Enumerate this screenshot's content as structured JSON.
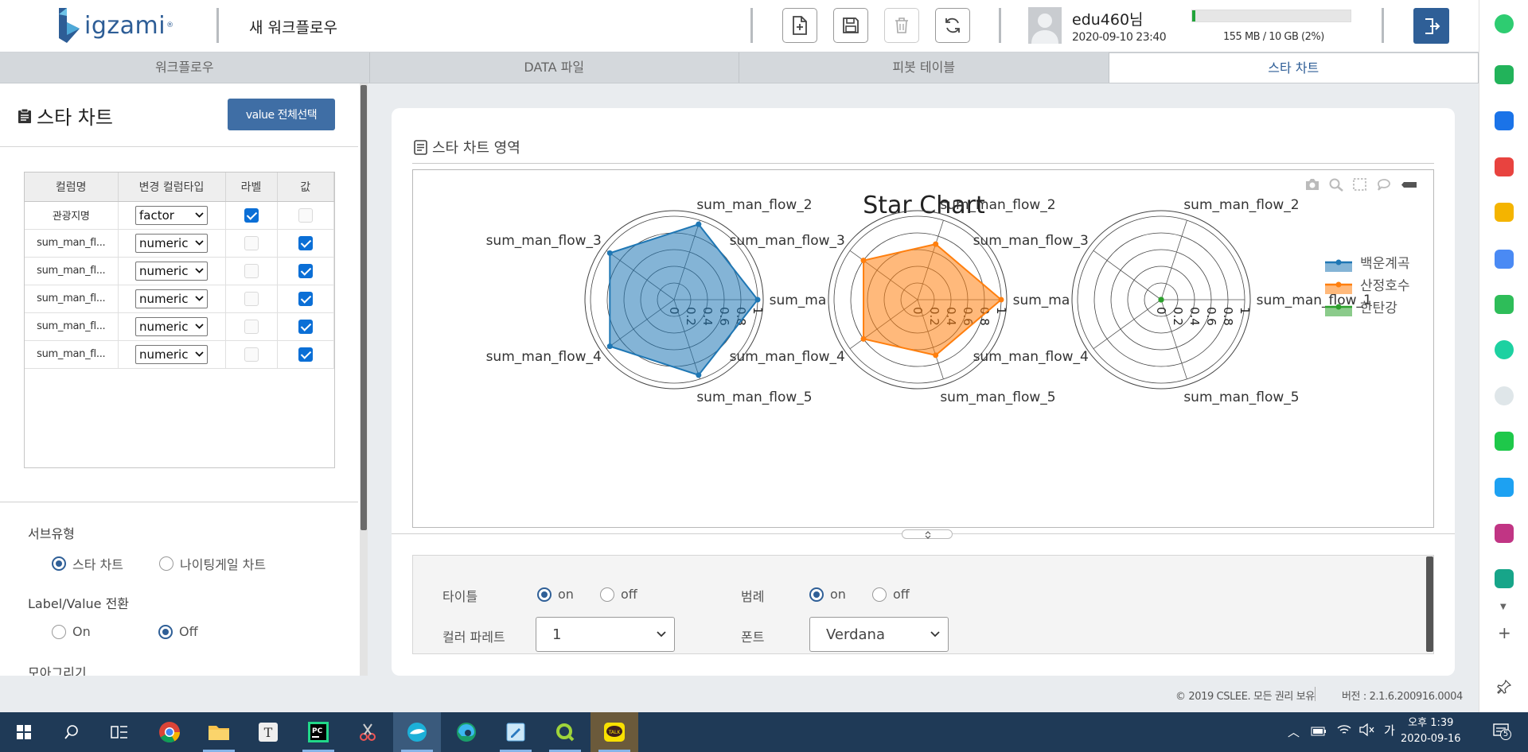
{
  "header": {
    "logo_text": "igzami",
    "logo_reg": "®",
    "workflow_title": "새 워크플로우",
    "user": {
      "name": "edu460님",
      "login_time": "2020-09-10 23:40"
    },
    "storage": {
      "text": "155 MB / 10 GB (2%)",
      "fraction": 0.02,
      "color": "#22a43a"
    },
    "toolbar_icons": [
      "new-file-icon",
      "save-icon",
      "trash-icon",
      "refresh-icon"
    ],
    "logout_icon": "logout-icon"
  },
  "tabs": [
    {
      "label": "워크플로우",
      "active": false
    },
    {
      "label": "DATA 파일",
      "active": false
    },
    {
      "label": "피봇 테이블",
      "active": false
    },
    {
      "label": "스타 차트",
      "active": true
    }
  ],
  "left_panel": {
    "title": "스타 차트",
    "select_all_label": "value 전체선택",
    "table": {
      "headers": [
        "컬럼명",
        "변경 컬럼타입",
        "라벨",
        "값"
      ],
      "rows": [
        {
          "name": "관광지명",
          "type": "factor",
          "label": true,
          "value": false
        },
        {
          "name": "sum_man_fl...",
          "type": "numeric",
          "label": false,
          "value": true
        },
        {
          "name": "sum_man_fl...",
          "type": "numeric",
          "label": false,
          "value": true
        },
        {
          "name": "sum_man_fl...",
          "type": "numeric",
          "label": false,
          "value": true
        },
        {
          "name": "sum_man_fl...",
          "type": "numeric",
          "label": false,
          "value": true
        },
        {
          "name": "sum_man_fl...",
          "type": "numeric",
          "label": false,
          "value": true
        }
      ]
    },
    "sub_type": {
      "label": "서브유형",
      "options": [
        "스타 차트",
        "나이팅게일 차트"
      ],
      "selected": "스타 차트"
    },
    "label_value_toggle": {
      "label": "Label/Value 전환",
      "options": [
        "On",
        "Off"
      ],
      "selected": "Off"
    },
    "group_label": "모아그리기"
  },
  "chart_area": {
    "section_title": "스타 차트 영역",
    "modebar_icons": [
      "camera-icon",
      "zoom-icon",
      "box-select-icon",
      "comment-icon",
      "plotly-logo-icon"
    ]
  },
  "chart_data": {
    "type": "radar",
    "title": "Star Chart",
    "axes": [
      "sum_man_flow_1",
      "sum_man_flow_2",
      "sum_man_flow_3",
      "sum_man_flow_4",
      "sum_man_flow_5"
    ],
    "axis_labels_shown": [
      "sum_ma",
      "sum_man_flow_2",
      "sum_man_flow_3",
      "sum_man_flow_4",
      "sum_man_flow_5"
    ],
    "last_axis_label_shown": "sum_man_flow_1",
    "radial_ticks": [
      "0",
      "0.2",
      "0.4",
      "0.6",
      "0.8",
      "1"
    ],
    "radial_range": [
      0,
      1
    ],
    "legend_position": "top-right",
    "series": [
      {
        "name": "백운계곡",
        "color": "#1f77b4",
        "values": [
          1.0,
          0.95,
          0.95,
          0.95,
          0.95
        ]
      },
      {
        "name": "산정호수",
        "color": "#ff7f0e",
        "values": [
          1.0,
          0.7,
          0.8,
          0.8,
          0.7
        ]
      },
      {
        "name": "한탄강",
        "color": "#2ca02c",
        "values": [
          0,
          0,
          0,
          0,
          0
        ]
      }
    ]
  },
  "settings": {
    "title_toggle": {
      "label": "타이틀",
      "on": "on",
      "off": "off",
      "selected": "on"
    },
    "legend_toggle": {
      "label": "범례",
      "on": "on",
      "off": "off",
      "selected": "on"
    },
    "palette": {
      "label": "컬러 파레트",
      "value": "1"
    },
    "font": {
      "label": "폰트",
      "value": "Verdana"
    }
  },
  "footer": {
    "copyright": "© 2019 CSLEE. 모든 권리 보유",
    "version": "버전 : 2.1.6.200916.0004"
  },
  "taskbar": {
    "time": "오후 1:39",
    "date": "2020-09-16",
    "ime": "가",
    "notification_count": "5"
  }
}
